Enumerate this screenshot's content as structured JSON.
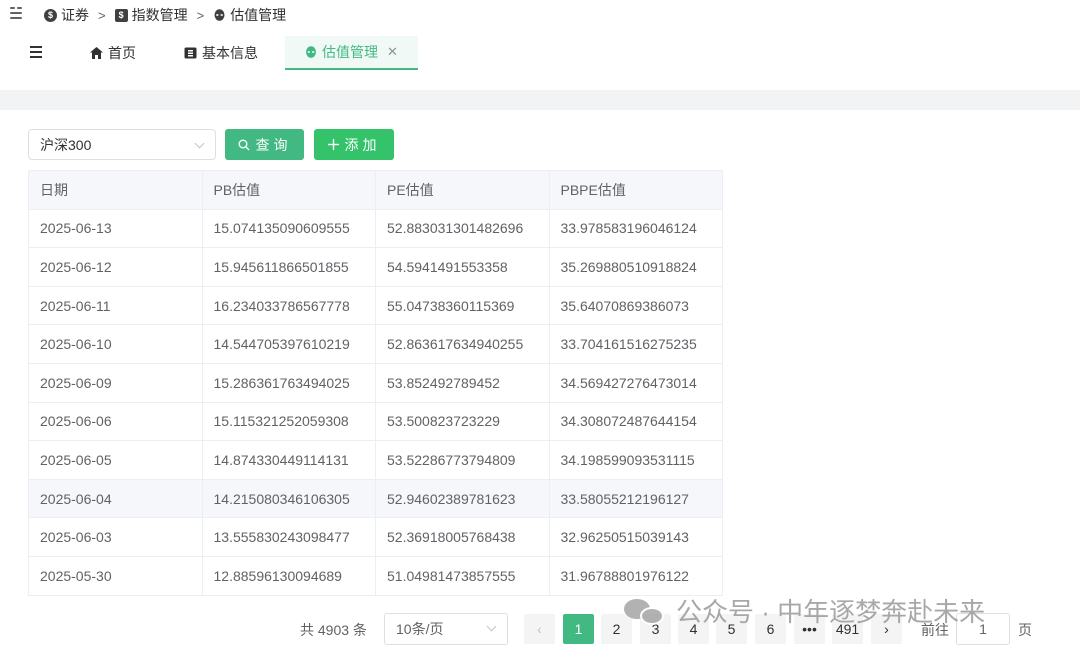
{
  "breadcrumb": [
    {
      "label": "证券",
      "icon": "coin-icon"
    },
    {
      "label": "指数管理",
      "icon": "dollar-square-icon"
    },
    {
      "label": "估值管理",
      "icon": "alien-icon"
    }
  ],
  "tabs": [
    {
      "label": "首页",
      "icon": "home-icon"
    },
    {
      "label": "基本信息",
      "icon": "info-card-icon"
    },
    {
      "label": "估值管理",
      "icon": "alien-icon",
      "active": true,
      "closable": true
    }
  ],
  "toolbar": {
    "index_select_value": "沪深300",
    "query_label": "查询",
    "add_label": "添加"
  },
  "table": {
    "columns": [
      "日期",
      "PB估值",
      "PE估值",
      "PBPE估值"
    ],
    "rows": [
      [
        "2025-06-13",
        "15.074135090609555",
        "52.883031301482696",
        "33.978583196046124"
      ],
      [
        "2025-06-12",
        "15.945611866501855",
        "54.5941491553358",
        "35.269880510918824"
      ],
      [
        "2025-06-11",
        "16.234033786567778",
        "55.04738360115369",
        "35.64070869386073"
      ],
      [
        "2025-06-10",
        "14.544705397610219",
        "52.863617634940255",
        "33.704161516275235"
      ],
      [
        "2025-06-09",
        "15.286361763494025",
        "53.852492789452",
        "34.569427276473014"
      ],
      [
        "2025-06-06",
        "15.115321252059308",
        "53.500823723229",
        "34.308072487644154"
      ],
      [
        "2025-06-05",
        "14.874330449114131",
        "53.52286773794809",
        "34.198599093531115"
      ],
      [
        "2025-06-04",
        "14.215080346106305",
        "52.94602389781623",
        "33.58055212196127"
      ],
      [
        "2025-06-03",
        "13.555830243098477",
        "52.36918005768438",
        "32.96250515039143"
      ],
      [
        "2025-05-30",
        "12.88596130094689",
        "51.04981473857555",
        "31.96788801976122"
      ]
    ]
  },
  "pagination": {
    "total_text": "共 4903 条",
    "page_size": "10条/页",
    "pages": [
      "1",
      "2",
      "3",
      "4",
      "5",
      "6",
      "•••",
      "491"
    ],
    "goto_label": "前往",
    "goto_value": "1",
    "goto_suffix": "页"
  },
  "watermark": {
    "text": "公众号 · 中年逐梦奔赴未来"
  },
  "colors": {
    "primary": "#42b983",
    "add": "#34c36a",
    "border": "#ebeef5"
  }
}
